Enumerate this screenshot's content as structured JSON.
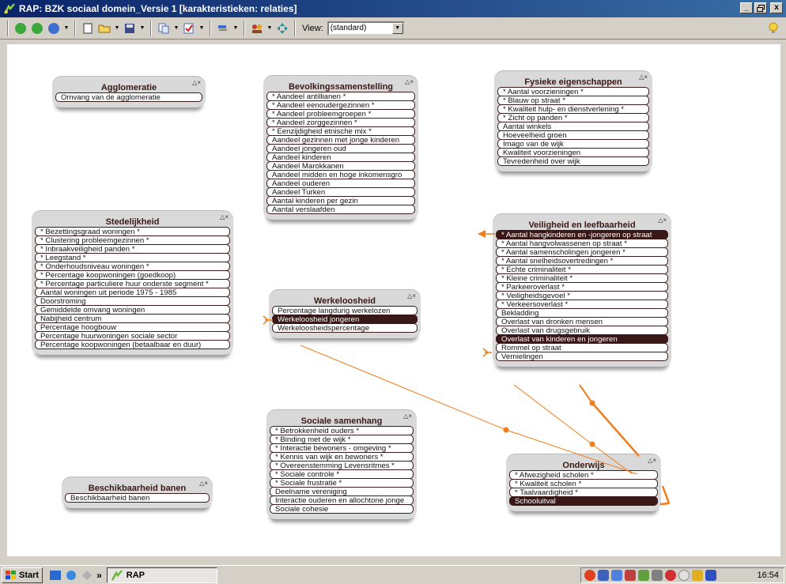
{
  "window": {
    "title": "RAP: BZK sociaal domein_Versie 1 [karakteristieken: relaties]",
    "min": "_",
    "max": "▫",
    "close": "x"
  },
  "toolbar": {
    "view_label": "View:",
    "view_value": "(standard)"
  },
  "panels": [
    {
      "id": "agglomeratie",
      "title": "Agglomeratie",
      "rows": [
        "Omvang van de agglomeratie"
      ],
      "selected": []
    },
    {
      "id": "bevolkingssamenstelling",
      "title": "Bevolkingssamenstelling",
      "rows": [
        "* Aandeel antillianen *",
        "* Aandeel eenoudergezinnen *",
        "* Aandeel probleemgroepen *",
        "* Aandeel zorggezinnen *",
        "* Eenzijdigheid etnische mix *",
        "Aandeel gezinnen met jonge kinderen",
        "Aandeel jongeren oud",
        "Aandeel kinderen",
        "Aandeel Marokkanen",
        "Aandeel midden en hoge inkomensgro",
        "Aandeel ouderen",
        "Aandeel Turken",
        "Aantal kinderen per gezin",
        "Aantal verslaafden"
      ],
      "selected": []
    },
    {
      "id": "fysieke",
      "title": "Fysieke eigenschappen",
      "rows": [
        "* Aantal voorzieningen *",
        "* Blauw op straat *",
        "* Kwaliteit hulp- en dienstverlening *",
        "* Zicht op panden *",
        "Aantal winkels",
        "Hoeveelheid groen",
        "Imago van de wijk",
        "Kwaliteit voorzieningen",
        "Tevredenheid over wijk"
      ],
      "selected": []
    },
    {
      "id": "stedelijkheid",
      "title": "Stedelijkheid",
      "rows": [
        "* Bezettingsgraad woningen *",
        "* Clustering probleemgezinnen *",
        "* Inbraakveiligheid panden *",
        "* Leegstand *",
        "* Onderhoudsniveau woningen *",
        "* Percentage koopwoningen (goedkoop)",
        "* Percentage particuliere huur onderste segment *",
        "Aantal woningen uit periode 1975 - 1985",
        "Doorstroming",
        "Gemiddelde omvang woningen",
        "Nabijheid centrum",
        "Percentage hoogbouw",
        "Percentage huurwoningen sociale sector",
        "Percentage koopwoningen (betaalbaar en duur)"
      ],
      "selected": []
    },
    {
      "id": "veiligheid",
      "title": "Veiligheid en leefbaarheid",
      "rows": [
        "* Aantal hangkinderen en -jongeren op straat",
        "* Aantal hangvolwassenen op straat *",
        "* Aantal samenscholingen jongeren *",
        "* Aantal snelheidsovertredingen *",
        "* Echte criminaliteit *",
        "* Kleine criminaliteit *",
        "* Parkeeroverlast *",
        "* Veiligheidsgevoel *",
        "* Verkeersoverlast *",
        "Bekladding",
        "Overlast van dronken mensen",
        "Overlast van drugsgebruik",
        "Overlast van kinderen en jongeren",
        "Rommel op straat",
        "Vernielingen"
      ],
      "selected": [
        0,
        12
      ]
    },
    {
      "id": "werkeloosheid",
      "title": "Werkeloosheid",
      "rows": [
        "Percentage langdurig werkelozen",
        "Werkeloosheid jongeren",
        "Werkeloosheidspercentage"
      ],
      "selected": [
        1
      ]
    },
    {
      "id": "sociale",
      "title": "Sociale samenhang",
      "rows": [
        "* Betrokkenheid ouders *",
        "* Binding met de wijk *",
        "* Interactie bewoners - omgeving *",
        "* Kennis van wijk en bewoners *",
        "* Overeenstemming Levensritmes *",
        "* Sociale controle *",
        "* Sociale frustratie *",
        "Deelname vereniging",
        "Interactie ouderen en allochtone jonge",
        "Sociale cohesie"
      ],
      "selected": []
    },
    {
      "id": "beschikbaarheid",
      "title": "Beschikbaarheid banen",
      "rows": [
        "Beschikbaarheid banen"
      ],
      "selected": []
    },
    {
      "id": "onderwijs",
      "title": "Onderwijs",
      "rows": [
        "* Afwezigheid scholen *",
        "* Kwaliteit scholen *",
        "* Taalvaardigheid *",
        "Schooluitval"
      ],
      "selected": [
        3
      ]
    }
  ],
  "panel_controls": "△×",
  "taskbar": {
    "start_label": "Start",
    "chevron": "»",
    "task_label": "RAP",
    "clock": "16:54"
  },
  "colors": {
    "accent_orange": "#f07c1a",
    "selected_row": "#3a1818",
    "panel_bg": "#d9d9d9"
  }
}
